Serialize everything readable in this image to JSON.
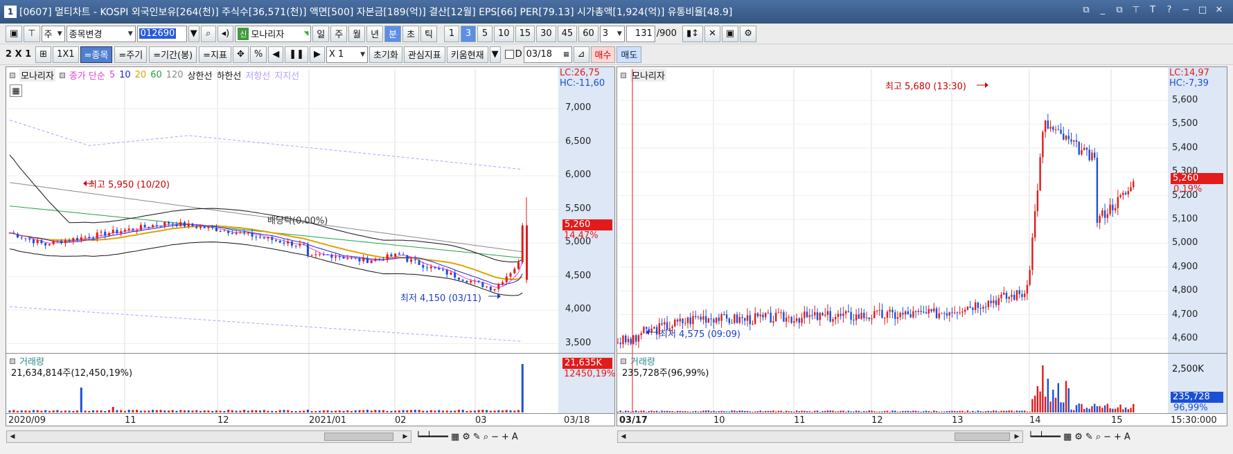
{
  "titlebar": {
    "num": "1",
    "title": "[0607] 멀티차트 - KOSPI 외국인보유[264(천)] 주식수[36,571(천)] 액면[500] 자본금[189(억)] 결산[12월] EPS[66] PER[79.13] 시가총액[1,924(억)] 유통비율[48.9]"
  },
  "toolbar1": {
    "ju": "주",
    "stock_select": "종목변경",
    "code": "012690",
    "monitor": "모나리자",
    "periods": [
      "일",
      "주",
      "월",
      "년",
      "분",
      "초",
      "틱"
    ],
    "active_period": "분",
    "minutes": [
      "1",
      "3",
      "5",
      "10",
      "15",
      "30",
      "45",
      "60"
    ],
    "active_minute": "3",
    "interval": "3",
    "count": "131",
    "count_max": "/900"
  },
  "toolbar2": {
    "layout": "2 X 1",
    "one": "1X1",
    "tabs": [
      "=종목",
      "=주기",
      "=기간(봉)",
      "=지표"
    ],
    "percent": "%",
    "multiplier": "X 1",
    "reset": "초기화",
    "watch": "관심지표",
    "kiwoom": "키움현재",
    "d": "D",
    "date": "03/18",
    "buy": "매수",
    "sell": "매도"
  },
  "left_chart": {
    "legend": {
      "name": "모나리자",
      "ma": "종가 단순",
      "p5": "5",
      "p10": "10",
      "p20": "20",
      "p60": "60",
      "p120": "120",
      "up": "상한선",
      "down": "하한선",
      "res": "저항선",
      "sup": "지지선"
    },
    "lc": "LC:26,75",
    "hc": "HC:-11,60",
    "price_ticks": [
      "7,000",
      "6,500",
      "6,000",
      "5,500",
      "5,000",
      "4,500",
      "4,000",
      "3,500"
    ],
    "current": "5,260",
    "change": "14,47%",
    "high": "최고 5,950 (10/20)",
    "low": "최저 4,150 (03/11)",
    "div": "배당락(0.00%)",
    "vol_label": "거래량",
    "vol_value": "21,634,814주(12,450,19%)",
    "vol_box": "21,635K",
    "vol_pct": "12450,19%",
    "xlabels": [
      "2020/09",
      "11",
      "12",
      "2021/01",
      "02",
      "03"
    ],
    "xend": "03/18",
    "colors": {
      "ma5": "#e040e0",
      "ma10": "#2222cc",
      "ma20": "#e0a000",
      "ma60": "#22a040",
      "ma120": "#888888",
      "band": "#111111",
      "res": "#b69bff",
      "up": "#e01a1a",
      "down": "#1a4fd6"
    }
  },
  "right_chart": {
    "name": "모나리자",
    "lc": "LC:14,97",
    "hc": "HC:-7,39",
    "price_ticks": [
      "5,600",
      "5,500",
      "5,400",
      "5,300",
      "5,200",
      "5,100",
      "5,000",
      "4,900",
      "4,800",
      "4,700",
      "4,600"
    ],
    "current": "5,260",
    "change": "0,19%",
    "high": "최고 5,680 (13:30)",
    "low": "최저 4,575 (09:09)",
    "vol_label": "거래량",
    "vol_value": "235,728주(96,99%)",
    "vol_tick": "2,500K",
    "vol_box": "235,728",
    "vol_pct": "96,99%",
    "xlabels": [
      "03/17",
      "10",
      "11",
      "12",
      "13",
      "14",
      "15"
    ],
    "xend": "15:30:000"
  }
}
